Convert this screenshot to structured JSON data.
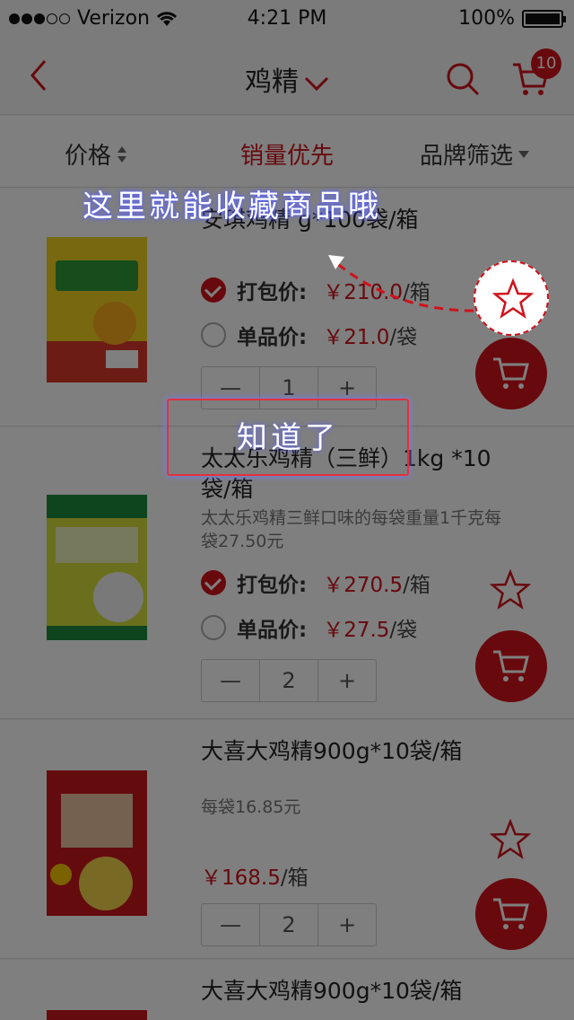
{
  "status": {
    "carrier": "Verizon",
    "time": "4:21 PM",
    "battery": "100%"
  },
  "nav": {
    "title": "鸡精",
    "cart_count": "10"
  },
  "tabs": [
    {
      "label": "价格"
    },
    {
      "label": "销量优先"
    },
    {
      "label": "品牌筛选"
    }
  ],
  "products": [
    {
      "name": "安琪鸡精 g*100袋/箱",
      "pack_label": "打包价:",
      "pack_price": "￥210.0",
      "pack_unit": "/箱",
      "single_label": "单品价:",
      "single_price": "￥21.0",
      "single_unit": "/袋",
      "qty": "1"
    },
    {
      "name": "太太乐鸡精（三鲜）1kg *10袋/箱",
      "desc": "太太乐鸡精三鲜口味的每袋重量1千克每袋27.50元",
      "pack_label": "打包价:",
      "pack_price": "￥270.5",
      "pack_unit": "/箱",
      "single_label": "单品价:",
      "single_price": "￥27.5",
      "single_unit": "/袋",
      "qty": "2"
    },
    {
      "name": "大喜大鸡精900g*10袋/箱",
      "desc": "每袋16.85元",
      "price": "￥168.5",
      "unit": "/箱",
      "qty": "2"
    },
    {
      "name": "大喜大鸡精900g*10袋/箱"
    }
  ],
  "stepper": {
    "minus": "—",
    "plus": "+"
  },
  "guide": {
    "tip": "这里就能收藏商品哦",
    "button": "知道了"
  },
  "colors": {
    "accent": "#d0121b"
  }
}
